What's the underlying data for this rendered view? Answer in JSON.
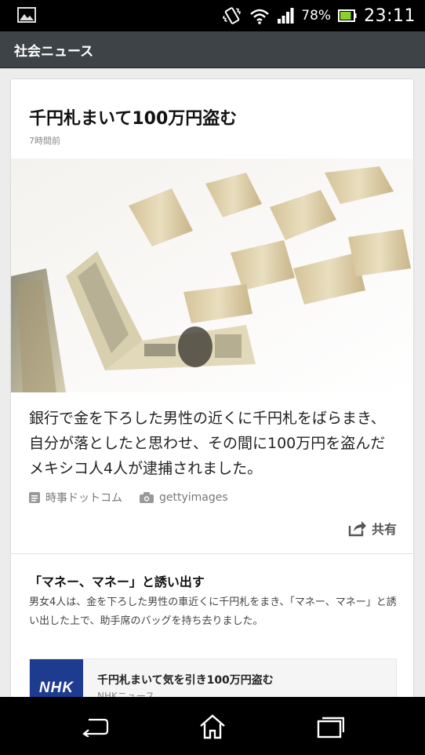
{
  "status_bar": {
    "battery_percent": "78%",
    "time": "23:11",
    "icons": [
      "gallery-icon",
      "vibrate-icon",
      "wifi-icon",
      "signal-icon",
      "battery-icon"
    ]
  },
  "app_bar": {
    "title": "社会ニュース"
  },
  "article": {
    "headline": "千円札まいて100万円盗む",
    "time_ago": "7時間前",
    "summary": "銀行で金を下ろした男性の近くに千円札をばらまき、自分が落としたと思わせ、その間に100万円を盗んだメキシコ人4人が逮捕されました。",
    "source": "時事ドットコム",
    "photo_credit": "gettyimages",
    "share_label": "共有"
  },
  "related": {
    "title": "「マネー、マネー」と誘い出す",
    "body": "男女4人は、金を下ろした男性の車近くに千円札をまき、「マネー、マネー」と誘い出した上で、助手席のバッグを持ち去りました。",
    "link": {
      "logo_text": "NHK",
      "title": "千円札まいて気を引き100万円盗む",
      "source": "NHKニュース"
    }
  },
  "colors": {
    "app_bar_bg": "#3d4347",
    "nhk_blue": "#1d3b8f",
    "battery_green": "#8bd12a"
  }
}
